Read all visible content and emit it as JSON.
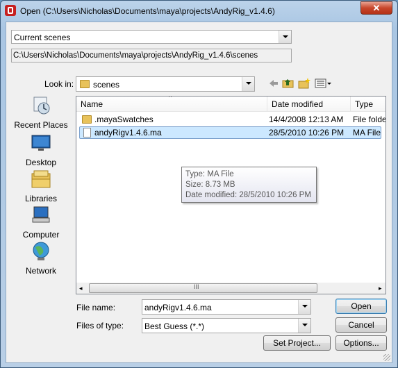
{
  "window": {
    "title": "Open (C:\\Users\\Nicholas\\Documents\\maya\\projects\\AndyRig_v1.4.6)",
    "close_glyph": "✕"
  },
  "project_filter": {
    "value": "Current scenes"
  },
  "path_display": "C:\\Users\\Nicholas\\Documents\\maya\\projects\\AndyRig_v1.4.6\\scenes",
  "look_in": {
    "label": "Look in:",
    "value": "scenes"
  },
  "places": [
    {
      "label": "Recent Places",
      "icon": "recent-places-icon"
    },
    {
      "label": "Desktop",
      "icon": "desktop-icon"
    },
    {
      "label": "Libraries",
      "icon": "libraries-icon"
    },
    {
      "label": "Computer",
      "icon": "computer-icon"
    },
    {
      "label": "Network",
      "icon": "network-icon"
    }
  ],
  "file_list": {
    "columns": [
      "Name",
      "Date modified",
      "Type"
    ],
    "sort_indicator": "^",
    "rows": [
      {
        "name": ".mayaSwatches",
        "date": "14/4/2008 12:13 AM",
        "type": "File folder",
        "icon": "folder-icon"
      },
      {
        "name": "andyRigv1.4.6.ma",
        "date": "28/5/2010 10:26 PM",
        "type": "MA File",
        "icon": "file-icon",
        "selected": true
      }
    ],
    "scroll_grip": "III"
  },
  "tooltip": {
    "type": "Type: MA File",
    "size": "Size: 8.73 MB",
    "date": "Date modified: 28/5/2010 10:26 PM"
  },
  "file_name": {
    "label": "File name:",
    "value": "andyRigv1.4.6.ma"
  },
  "files_of_type": {
    "label": "Files of type:",
    "value": "Best Guess (*.*)"
  },
  "buttons": {
    "open": "Open",
    "cancel": "Cancel",
    "set_project": "Set Project...",
    "options": "Options..."
  },
  "colors": {
    "selection": "#cce8ff",
    "close_button": "#c7462b",
    "folder": "#e8c25a"
  }
}
